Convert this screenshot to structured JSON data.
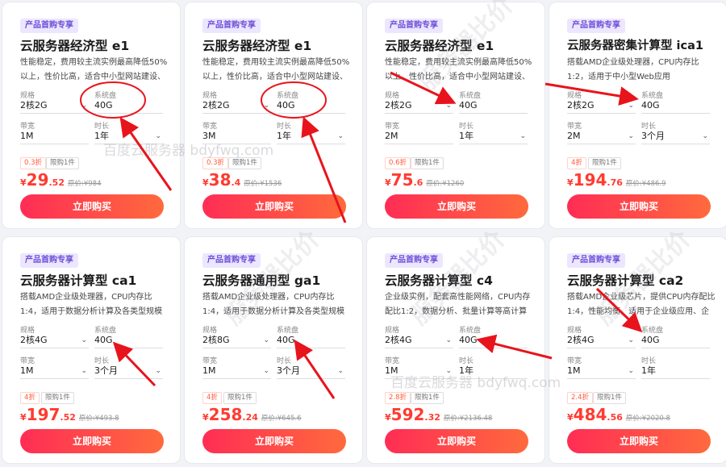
{
  "field_labels": {
    "spec": "规格",
    "disk": "系统盘",
    "bandwidth": "带宽",
    "duration": "时长"
  },
  "badge": "产品首购专享",
  "buy_label": "立即购买",
  "limit_label": "限购1件",
  "currency": "¥",
  "watermark_text": "百度云服务器 bdyfwq.com",
  "diag_watermark": "服务器比价",
  "cards": [
    {
      "title": "云服务器经济型 e1",
      "desc": "性能稳定，费用较主流实例最高降低50%以上，性价比高，适合中小型网站建设、开…",
      "spec": "2核2G",
      "disk": "40G",
      "bandwidth": "1M",
      "duration": "1年",
      "discount": "0.3折",
      "price_int": "29",
      "price_dec": ".52",
      "orig": "原价:¥984"
    },
    {
      "title": "云服务器经济型 e1",
      "desc": "性能稳定，费用较主流实例最高降低50%以上，性价比高，适合中小型网站建设、开…",
      "spec": "2核2G",
      "disk": "40G",
      "bandwidth": "3M",
      "duration": "1年",
      "discount": "0.3折",
      "price_int": "38",
      "price_dec": ".4",
      "orig": "原价:¥1536"
    },
    {
      "title": "云服务器经济型 e1",
      "desc": "性能稳定，费用较主流实例最高降低50%以上，性价比高，适合中小型网站建设、开…",
      "spec": "2核2G",
      "disk": "40G",
      "bandwidth": "2M",
      "duration": "1年",
      "discount": "0.6折",
      "price_int": "75",
      "price_dec": ".6",
      "orig": "原价:¥1260"
    },
    {
      "title": "云服务器密集计算型 ica1",
      "desc": "搭载AMD企业级处理器，CPU内存比1:2，适用于中小型Web应用",
      "spec": "2核2G",
      "disk": "40G",
      "bandwidth": "2M",
      "duration": "3个月",
      "discount": "4折",
      "price_int": "194",
      "price_dec": ".76",
      "orig": "原价:¥486.9"
    },
    {
      "title": "云服务器计算型 ca1",
      "desc": "搭载AMD企业级处理器，CPU内存比1:4，适用于数据分析计算及各类型规模企业级应用",
      "spec": "2核4G",
      "disk": "40G",
      "bandwidth": "1M",
      "duration": "3个月",
      "discount": "4折",
      "price_int": "197",
      "price_dec": ".52",
      "orig": "原价:¥493.8"
    },
    {
      "title": "云服务器通用型 ga1",
      "desc": "搭载AMD企业级处理器，CPU内存比1:4，适用于数据分析计算及各类型规模企业级应用",
      "spec": "2核8G",
      "disk": "40G",
      "bandwidth": "1M",
      "duration": "3个月",
      "discount": "4折",
      "price_int": "258",
      "price_dec": ".24",
      "orig": "原价:¥645.6"
    },
    {
      "title": "云服务器计算型 c4",
      "desc": "企业级实例，配套高性能网络，CPU内存配比1:2，数据分析、批量计算等高计算需求…",
      "spec": "2核4G",
      "disk": "40G",
      "bandwidth": "1M",
      "duration": "1年",
      "discount": "2.8折",
      "price_int": "592",
      "price_dec": ".32",
      "orig": "原价:¥2136.48"
    },
    {
      "title": "云服务器计算型 ca2",
      "desc": "搭载AMD企业级芯片，提供CPU内存配比1:4，性能均衡，适用于企业级应用、企业…",
      "spec": "2核4G",
      "disk": "40G",
      "bandwidth": "1M",
      "duration": "1年",
      "discount": "2.4折",
      "price_int": "484",
      "price_dec": ".56",
      "orig": "原价:¥2020.8"
    }
  ],
  "colors": {
    "accent": "#ff3b30",
    "badge_bg": "#ece6ff",
    "badge_fg": "#6b4fd6",
    "arrow": "#e8141c"
  }
}
